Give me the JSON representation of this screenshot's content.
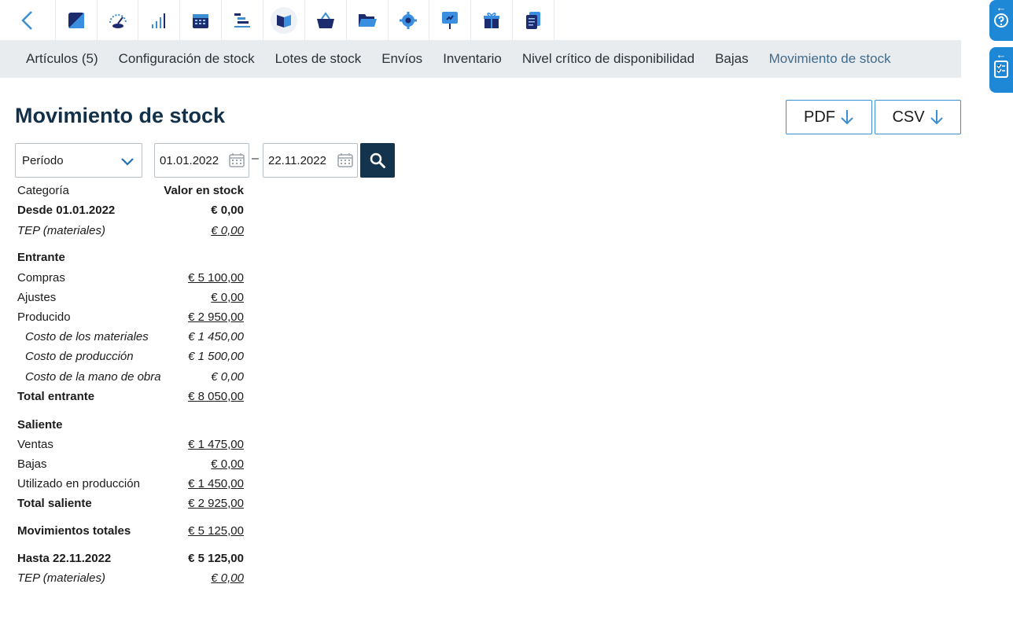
{
  "icons": [
    "back-chevron-icon",
    "dashboard-square-icon",
    "speedometer-icon",
    "signal-bars-icon",
    "calendar-icon",
    "gantt-icon",
    "book-icon",
    "basket-icon",
    "folder-icon",
    "gear-icon",
    "presentation-icon",
    "gift-icon",
    "documents-icon"
  ],
  "subnav": {
    "tabs": [
      "Artículos (5)",
      "Configuración de stock",
      "Lotes de stock",
      "Envíos",
      "Inventario",
      "Nivel crítico de disponibilidad",
      "Bajas",
      "Movimiento de stock"
    ],
    "active_index": 7
  },
  "page": {
    "title": "Movimiento de stock",
    "pdf_label": "PDF",
    "csv_label": "CSV"
  },
  "filters": {
    "period_label": "Período",
    "date_from": "01.01.2022",
    "separator": "–",
    "date_to": "22.11.2022"
  },
  "table": {
    "header": {
      "label": "Categoría",
      "value": "Valor en stock"
    },
    "rows": [
      {
        "label": "Desde 01.01.2022",
        "value": "€ 0,00"
      },
      {
        "label": "TEP (materiales)",
        "value": "€ 0,00"
      },
      {
        "label": "Entrante",
        "value": ""
      },
      {
        "label": "Compras",
        "value": "€ 5 100,00"
      },
      {
        "label": "Ajustes",
        "value": "€ 0,00"
      },
      {
        "label": "Producido",
        "value": "€ 2 950,00"
      },
      {
        "label": "Costo de los materiales",
        "value": "€ 1 450,00"
      },
      {
        "label": "Costo de producción",
        "value": "€ 1 500,00"
      },
      {
        "label": "Costo de la mano de obra",
        "value": "€ 0,00"
      },
      {
        "label": "Total entrante",
        "value": "€ 8 050,00"
      },
      {
        "label": "Saliente",
        "value": ""
      },
      {
        "label": "Ventas",
        "value": "€ 1 475,00"
      },
      {
        "label": "Bajas",
        "value": "€ 0,00"
      },
      {
        "label": "Utilizado en producción",
        "value": "€ 1 450,00"
      },
      {
        "label": "Total saliente",
        "value": "€ 2 925,00"
      },
      {
        "label": "Movimientos totales",
        "value": "€ 5 125,00"
      },
      {
        "label": "Hasta 22.11.2022",
        "value": "€ 5 125,00"
      },
      {
        "label": "TEP (materiales)",
        "value": "€ 0,00"
      }
    ]
  },
  "colors": {
    "accent": "#1e88d6",
    "title": "#123049",
    "search_button": "#14334d",
    "subnav_bg": "#e9ecef"
  }
}
